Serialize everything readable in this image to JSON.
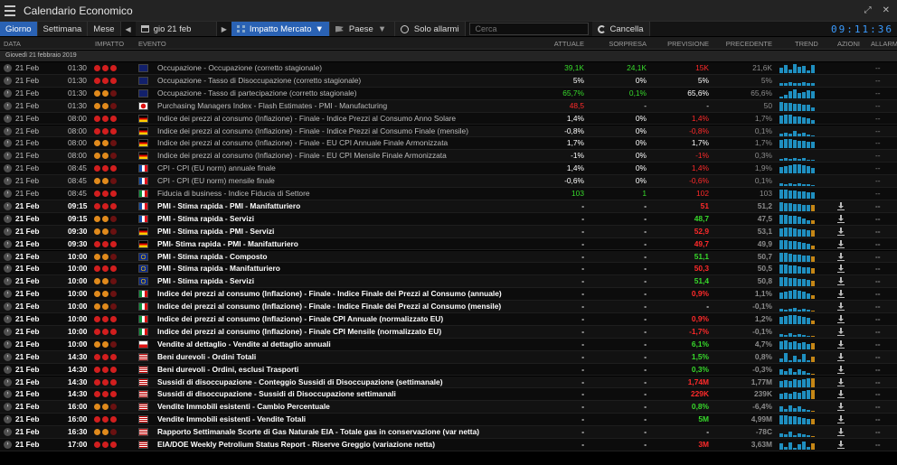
{
  "app": {
    "title": "Calendario Economico"
  },
  "toolbar": {
    "day": "Giorno",
    "week": "Settimana",
    "month": "Mese",
    "date": "gio 21 feb",
    "impact": "Impatto Mercato",
    "country": "Paese",
    "alarms_only": "Solo allarmi",
    "search_placeholder": "Cerca",
    "clear": "Cancella",
    "clock": "09:11:36"
  },
  "columns": {
    "date": "DATA",
    "impact": "IMPATTO",
    "event": "EVENTO",
    "actual": "ATTUALE",
    "surprise": "SORPRESA",
    "forecast": "PREVISIONE",
    "previous": "PRECEDENTE",
    "trend": "TREND",
    "actions": "AZIONI",
    "alarms": "ALLARMI"
  },
  "group": "Giovedì 21 febbraio 2019",
  "colors": {
    "accent": "#2a62b4",
    "clock": "#3a9bff",
    "positive": "#37d92b",
    "negative": "#ff2a2a",
    "trend_bar": "#1f8fc0",
    "trend_bar_alt": "#c58616",
    "impact_high": "#d21e1e",
    "impact_medium": "#e08a1c",
    "impact_low": "#6a1111"
  },
  "rows": [
    {
      "date": "21 Feb",
      "time": "01:30",
      "impact": 3,
      "flag": "au",
      "event": "Occupazione - Occupazione (corretto stagionale)",
      "actual": "39,1K",
      "act_c": "green",
      "surprise": "24,1K",
      "sur_c": "green",
      "forecast": "15K",
      "fc_c": "red",
      "previous": "21,6K",
      "state": "done",
      "trend": [
        5,
        8,
        4,
        9,
        6,
        7,
        3,
        8
      ],
      "alarm": "--"
    },
    {
      "date": "21 Feb",
      "time": "01:30",
      "impact": 3,
      "flag": "au",
      "event": "Occupazione - Tasso di Disoccupazione (corretto stagionale)",
      "actual": "5%",
      "act_c": "white",
      "surprise": "0%",
      "sur_c": "white",
      "forecast": "5%",
      "fc_c": "white",
      "previous": "5%",
      "state": "done",
      "trend": [
        3,
        3,
        4,
        3,
        3,
        4,
        3,
        3
      ],
      "alarm": "--"
    },
    {
      "date": "21 Feb",
      "time": "01:30",
      "impact": 2,
      "flag": "au",
      "event": "Occupazione - Tasso di partecipazione (corretto stagionale)",
      "actual": "65,7%",
      "act_c": "green",
      "surprise": "0,1%",
      "sur_c": "green",
      "forecast": "65,6%",
      "fc_c": "white",
      "previous": "65,6%",
      "state": "done",
      "trend": [
        2,
        4,
        7,
        9,
        5,
        6,
        8,
        7
      ],
      "alarm": "--"
    },
    {
      "date": "21 Feb",
      "time": "01:30",
      "impact": 2,
      "flag": "jp",
      "event": "Purchasing Managers Index - Flash Estimates - PMI - Manufacturing",
      "actual": "48,5",
      "act_c": "red",
      "surprise": "-",
      "sur_c": "white",
      "forecast": "-",
      "fc_c": "white",
      "previous": "50",
      "state": "done",
      "trend": [
        9,
        8,
        8,
        7,
        7,
        6,
        6,
        4
      ],
      "alarm": "--"
    },
    {
      "date": "21 Feb",
      "time": "08:00",
      "impact": 3,
      "flag": "de",
      "event": "Indice dei prezzi al consumo (Inflazione) - Finale - Indice Prezzi al Consumo Anno Solare",
      "actual": "1,4%",
      "act_c": "white",
      "surprise": "0%",
      "sur_c": "white",
      "forecast": "1,4%",
      "fc_c": "red",
      "previous": "1,7%",
      "state": "done",
      "trend": [
        8,
        9,
        9,
        7,
        7,
        6,
        5,
        4
      ],
      "alarm": "--"
    },
    {
      "date": "21 Feb",
      "time": "08:00",
      "impact": 3,
      "flag": "de",
      "event": "Indice dei prezzi al consumo (Inflazione) - Finale - Indice Prezzi al Consumo Finale (mensile)",
      "actual": "-0,8%",
      "act_c": "white",
      "surprise": "0%",
      "sur_c": "white",
      "forecast": "-0,8%",
      "fc_c": "red",
      "previous": "0,1%",
      "state": "done",
      "trend": [
        3,
        4,
        3,
        5,
        3,
        4,
        2,
        1
      ],
      "alarm": "--"
    },
    {
      "date": "21 Feb",
      "time": "08:00",
      "impact": 2,
      "flag": "de",
      "event": "Indice dei prezzi al consumo (Inflazione) - Finale - EU CPI Annuale Finale Armonizzata",
      "actual": "1,7%",
      "act_c": "white",
      "surprise": "0%",
      "sur_c": "white",
      "forecast": "1,7%",
      "fc_c": "white",
      "previous": "1,7%",
      "state": "done",
      "trend": [
        8,
        9,
        9,
        8,
        7,
        7,
        6,
        6
      ],
      "alarm": "--"
    },
    {
      "date": "21 Feb",
      "time": "08:00",
      "impact": 2,
      "flag": "de",
      "event": "Indice dei prezzi al consumo (Inflazione) - Finale - EU CPI Mensile Finale Armonizzata",
      "actual": "-1%",
      "act_c": "white",
      "surprise": "0%",
      "sur_c": "white",
      "forecast": "-1%",
      "fc_c": "red",
      "previous": "0,3%",
      "state": "done",
      "trend": [
        2,
        3,
        2,
        3,
        2,
        3,
        1,
        1
      ],
      "alarm": "--"
    },
    {
      "date": "21 Feb",
      "time": "08:45",
      "impact": 3,
      "flag": "fr",
      "event": "CPI - CPI (EU norm) annuale finale",
      "actual": "1,4%",
      "act_c": "white",
      "surprise": "0%",
      "sur_c": "white",
      "forecast": "1,4%",
      "fc_c": "red",
      "previous": "1,9%",
      "state": "done",
      "trend": [
        6,
        7,
        8,
        9,
        9,
        8,
        7,
        5
      ],
      "alarm": "--"
    },
    {
      "date": "21 Feb",
      "time": "08:45",
      "impact": 2,
      "flag": "fr",
      "event": "CPI - CPI (EU norm) mensile finale",
      "actual": "-0,6%",
      "act_c": "white",
      "surprise": "0%",
      "sur_c": "white",
      "forecast": "-0,6%",
      "fc_c": "red",
      "previous": "0,1%",
      "state": "done",
      "trend": [
        3,
        2,
        3,
        2,
        3,
        2,
        2,
        1
      ],
      "alarm": "--"
    },
    {
      "date": "21 Feb",
      "time": "08:45",
      "impact": 3,
      "flag": "it",
      "event": "Fiducia di business - Indice Fiducia di Settore",
      "actual": "103",
      "act_c": "green",
      "surprise": "1",
      "sur_c": "green",
      "forecast": "102",
      "fc_c": "red",
      "previous": "103",
      "state": "done",
      "trend": [
        9,
        9,
        8,
        8,
        7,
        7,
        6,
        6
      ],
      "alarm": "--"
    },
    {
      "date": "21 Feb",
      "time": "09:15",
      "impact": 3,
      "flag": "fr",
      "event": "PMI - Stima rapida - PMI - Manifatturiero",
      "actual": "-",
      "act_c": "white",
      "surprise": "-",
      "sur_c": "white",
      "forecast": "51",
      "fc_c": "red",
      "previous": "51,2",
      "state": "future",
      "trend": [
        9,
        8,
        8,
        7,
        7,
        6,
        6,
        6
      ],
      "alarm": "--"
    },
    {
      "date": "21 Feb",
      "time": "09:15",
      "impact": 2,
      "flag": "fr",
      "event": "PMI - Stima rapida - Servizi",
      "actual": "-",
      "act_c": "white",
      "surprise": "-",
      "sur_c": "white",
      "forecast": "48,7",
      "fc_c": "green",
      "previous": "47,5",
      "state": "future",
      "trend": [
        9,
        9,
        8,
        8,
        7,
        5,
        4,
        4
      ],
      "alarm": "--"
    },
    {
      "date": "21 Feb",
      "time": "09:30",
      "impact": 2,
      "flag": "de",
      "event": "PMI - Stima rapida - PMI - Servizi",
      "actual": "-",
      "act_c": "white",
      "surprise": "-",
      "sur_c": "white",
      "forecast": "52,9",
      "fc_c": "red",
      "previous": "53,1",
      "state": "future",
      "trend": [
        8,
        9,
        9,
        8,
        7,
        7,
        6,
        6
      ],
      "alarm": "--"
    },
    {
      "date": "21 Feb",
      "time": "09:30",
      "impact": 3,
      "flag": "de",
      "event": "PMI- Stima rapida - PMI - Manifatturiero",
      "actual": "-",
      "act_c": "white",
      "surprise": "-",
      "sur_c": "white",
      "forecast": "49,7",
      "fc_c": "red",
      "previous": "49,9",
      "state": "future",
      "trend": [
        9,
        9,
        8,
        8,
        7,
        6,
        5,
        4
      ],
      "alarm": "--"
    },
    {
      "date": "21 Feb",
      "time": "10:00",
      "impact": 2,
      "flag": "eu",
      "event": "PMI - Stima rapida - Composto",
      "actual": "-",
      "act_c": "white",
      "surprise": "-",
      "sur_c": "white",
      "forecast": "51,1",
      "fc_c": "green",
      "previous": "50,7",
      "state": "future",
      "trend": [
        9,
        9,
        8,
        7,
        7,
        6,
        6,
        5
      ],
      "alarm": "--"
    },
    {
      "date": "21 Feb",
      "time": "10:00",
      "impact": 3,
      "flag": "eu",
      "event": "PMI - Stima rapida - Manifatturiero",
      "actual": "-",
      "act_c": "white",
      "surprise": "-",
      "sur_c": "white",
      "forecast": "50,3",
      "fc_c": "red",
      "previous": "50,5",
      "state": "future",
      "trend": [
        9,
        9,
        8,
        8,
        7,
        6,
        6,
        5
      ],
      "alarm": "--"
    },
    {
      "date": "21 Feb",
      "time": "10:00",
      "impact": 2,
      "flag": "eu",
      "event": "PMI - Stima rapida - Servizi",
      "actual": "-",
      "act_c": "white",
      "surprise": "-",
      "sur_c": "white",
      "forecast": "51,4",
      "fc_c": "green",
      "previous": "50,8",
      "state": "future",
      "trend": [
        9,
        9,
        8,
        8,
        7,
        7,
        6,
        5
      ],
      "alarm": "--"
    },
    {
      "date": "21 Feb",
      "time": "10:00",
      "impact": 2,
      "flag": "it",
      "event": "Indice dei prezzi al consumo (Inflazione) - Finale - Indice Finale dei Prezzi al Consumo (annuale)",
      "actual": "-",
      "act_c": "white",
      "surprise": "-",
      "sur_c": "white",
      "forecast": "0,9%",
      "fc_c": "red",
      "previous": "1,1%",
      "state": "future",
      "trend": [
        6,
        7,
        8,
        9,
        8,
        7,
        5,
        4
      ],
      "alarm": "--"
    },
    {
      "date": "21 Feb",
      "time": "10:00",
      "impact": 2,
      "flag": "it",
      "event": "Indice dei prezzi al consumo (Inflazione) - Finale - Indice Finale dei Prezzi al Consumo (mensile)",
      "actual": "-",
      "act_c": "white",
      "surprise": "-",
      "sur_c": "white",
      "forecast": "-",
      "fc_c": "white",
      "previous": "-0,1%",
      "state": "future",
      "trend": [
        3,
        2,
        3,
        4,
        2,
        3,
        2,
        1
      ],
      "alarm": "--"
    },
    {
      "date": "21 Feb",
      "time": "10:00",
      "impact": 3,
      "flag": "it",
      "event": "Indice dei prezzi al consumo (Inflazione) - Finale CPI Annuale (normalizzato EU)",
      "actual": "-",
      "act_c": "white",
      "surprise": "-",
      "sur_c": "white",
      "forecast": "0,9%",
      "fc_c": "red",
      "previous": "1,2%",
      "state": "future",
      "trend": [
        7,
        8,
        9,
        9,
        8,
        7,
        6,
        4
      ],
      "alarm": "--"
    },
    {
      "date": "21 Feb",
      "time": "10:00",
      "impact": 3,
      "flag": "it",
      "event": "Indice dei prezzi al consumo (Inflazione) - Finale CPI Mensile (normalizzato EU)",
      "actual": "-",
      "act_c": "white",
      "surprise": "-",
      "sur_c": "white",
      "forecast": "-1,7%",
      "fc_c": "red",
      "previous": "-0,1%",
      "state": "future",
      "trend": [
        3,
        2,
        4,
        2,
        3,
        2,
        1,
        1
      ],
      "alarm": "--"
    },
    {
      "date": "21 Feb",
      "time": "10:00",
      "impact": 2,
      "flag": "pl",
      "event": "Vendite al dettaglio - Vendite al dettaglio annuali",
      "actual": "-",
      "act_c": "white",
      "surprise": "-",
      "sur_c": "white",
      "forecast": "6,1%",
      "fc_c": "green",
      "previous": "4,7%",
      "state": "future",
      "trend": [
        8,
        9,
        7,
        8,
        6,
        7,
        5,
        6
      ],
      "alarm": "--"
    },
    {
      "date": "21 Feb",
      "time": "14:30",
      "impact": 3,
      "flag": "us",
      "event": "Beni durevoli - Ordini Totali",
      "actual": "-",
      "act_c": "white",
      "surprise": "-",
      "sur_c": "white",
      "forecast": "1,5%",
      "fc_c": "green",
      "previous": "0,8%",
      "state": "future",
      "trend": [
        4,
        9,
        2,
        6,
        3,
        8,
        2,
        5
      ],
      "alarm": "--"
    },
    {
      "date": "21 Feb",
      "time": "14:30",
      "impact": 3,
      "flag": "us",
      "event": "Beni durevoli - Ordini, esclusi Trasporti",
      "actual": "-",
      "act_c": "white",
      "surprise": "-",
      "sur_c": "white",
      "forecast": "0,3%",
      "fc_c": "green",
      "previous": "-0,3%",
      "state": "future",
      "trend": [
        5,
        4,
        6,
        3,
        5,
        4,
        2,
        1
      ],
      "alarm": "--"
    },
    {
      "date": "21 Feb",
      "time": "14:30",
      "impact": 3,
      "flag": "us",
      "event": "Sussidi di disoccupazione - Conteggio Sussidi di Disoccupazione (settimanale)",
      "actual": "-",
      "act_c": "white",
      "surprise": "-",
      "sur_c": "white",
      "forecast": "1,74M",
      "fc_c": "red",
      "previous": "1,77M",
      "state": "future",
      "trend": [
        6,
        7,
        6,
        8,
        7,
        8,
        9,
        9
      ],
      "alarm": "--"
    },
    {
      "date": "21 Feb",
      "time": "14:30",
      "impact": 3,
      "flag": "us",
      "event": "Sussidi di disoccupazione - Sussidi di Disoccupazione settimanali",
      "actual": "-",
      "act_c": "white",
      "surprise": "-",
      "sur_c": "white",
      "forecast": "229K",
      "fc_c": "red",
      "previous": "239K",
      "state": "future",
      "trend": [
        5,
        6,
        5,
        7,
        6,
        8,
        9,
        9
      ],
      "alarm": "--"
    },
    {
      "date": "21 Feb",
      "time": "16:00",
      "impact": 2,
      "flag": "us",
      "event": "Vendite Immobili esistenti - Cambio Percentuale",
      "actual": "-",
      "act_c": "white",
      "surprise": "-",
      "sur_c": "white",
      "forecast": "0,8%",
      "fc_c": "green",
      "previous": "-6,4%",
      "state": "future",
      "trend": [
        5,
        3,
        6,
        4,
        5,
        3,
        2,
        1
      ],
      "alarm": "--"
    },
    {
      "date": "21 Feb",
      "time": "16:00",
      "impact": 3,
      "flag": "us",
      "event": "Vendite Immobili esistenti - Vendite Totali",
      "actual": "-",
      "act_c": "white",
      "surprise": "-",
      "sur_c": "white",
      "forecast": "5M",
      "fc_c": "green",
      "previous": "4,99M",
      "state": "future",
      "trend": [
        9,
        9,
        8,
        8,
        7,
        6,
        5,
        5
      ],
      "alarm": "--"
    },
    {
      "date": "21 Feb",
      "time": "16:30",
      "impact": 2,
      "flag": "us",
      "event": "Rapporto Settimanale Scorte di Gas Naturale EIA - Totale gas in conservazione (var netta)",
      "actual": "-",
      "act_c": "white",
      "surprise": "-",
      "sur_c": "white",
      "forecast": "-",
      "fc_c": "white",
      "previous": "-78C",
      "state": "future",
      "trend": [
        4,
        3,
        5,
        2,
        4,
        3,
        2,
        1
      ],
      "alarm": "--"
    },
    {
      "date": "21 Feb",
      "time": "17:00",
      "impact": 3,
      "flag": "us",
      "event": "EIA/DOE Weekly Petrolium Status Report - Riserve Greggio (variazione netta)",
      "actual": "-",
      "act_c": "white",
      "surprise": "-",
      "sur_c": "white",
      "forecast": "3M",
      "fc_c": "red",
      "previous": "3,63M",
      "state": "future",
      "trend": [
        6,
        3,
        7,
        2,
        5,
        8,
        3,
        6
      ],
      "alarm": "--"
    }
  ]
}
